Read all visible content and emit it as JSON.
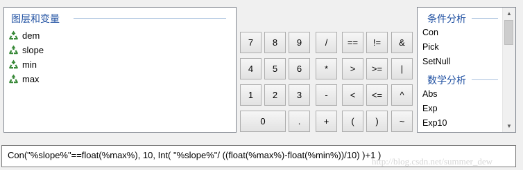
{
  "layers_panel": {
    "title": "图层和变量",
    "items": [
      {
        "label": "dem",
        "icon": "recycle-layer-icon"
      },
      {
        "label": "slope",
        "icon": "recycle-layer-icon"
      },
      {
        "label": "min",
        "icon": "recycle-layer-icon"
      },
      {
        "label": "max",
        "icon": "recycle-layer-icon"
      }
    ]
  },
  "keypad": {
    "row1": [
      "7",
      "8",
      "9",
      "/",
      "==",
      "!=",
      "&"
    ],
    "row2": [
      "4",
      "5",
      "6",
      "*",
      ">",
      ">=",
      "|"
    ],
    "row3": [
      "1",
      "2",
      "3",
      "-",
      "<",
      "<=",
      "^"
    ],
    "row4": [
      "0",
      ".",
      "+",
      "(",
      ")",
      "~"
    ]
  },
  "functions_panel": {
    "conditional_title": "条件分析",
    "conditional_items": [
      "Con",
      "Pick",
      "SetNull"
    ],
    "math_title": "数学分析",
    "math_items": [
      "Abs",
      "Exp",
      "Exp10"
    ]
  },
  "expression": {
    "value": "Con(\"%slope%\"==float(%max%), 10, Int( \"%slope%\"/ ((float(%max%)-float(%min%))/10) )+1 )"
  },
  "watermark": "http://blog.csdn.net/summer_dew",
  "colors": {
    "group_title": "#1e4fa1",
    "group_line": "#a9c1de",
    "icon_green": "#3a8a3a"
  }
}
